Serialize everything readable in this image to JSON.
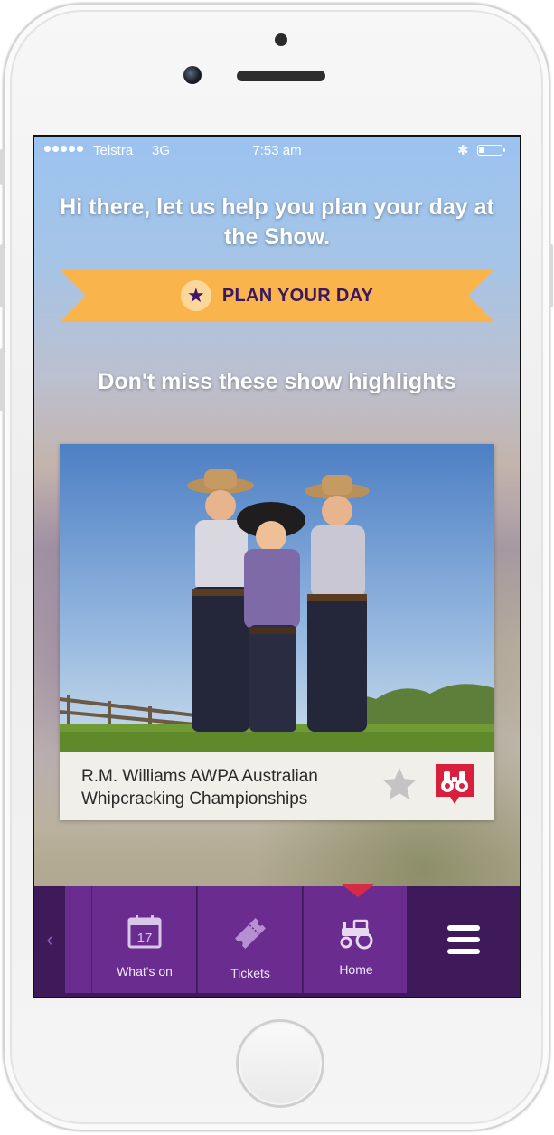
{
  "status_bar": {
    "carrier": "Telstra",
    "network": "3G",
    "time": "7:53 am",
    "battery_level": 0.25
  },
  "main": {
    "headline": "Hi there, let us help you plan your day at the Show.",
    "plan_button_label": "PLAN YOUR DAY",
    "subheading": "Don't miss these show highlights",
    "highlight": {
      "title": "R.M. Williams AWPA Australian Whipcracking Championships"
    }
  },
  "tab_bar": {
    "back_icon": "chevron-left-icon",
    "tabs": [
      {
        "label": "What's on",
        "icon": "calendar-icon",
        "calendar_day": "17"
      },
      {
        "label": "Tickets",
        "icon": "ticket-icon"
      },
      {
        "label": "Home",
        "icon": "tractor-icon",
        "active": true
      }
    ],
    "menu_icon": "hamburger-menu-icon"
  },
  "colors": {
    "ribbon": "#f9b54b",
    "ribbon_text": "#3a1760",
    "tab_bar_dark": "#3e1a5b",
    "tab_purple": "#6a2c8f",
    "active_pointer": "#d52b46",
    "badge_red": "#d8203e"
  }
}
